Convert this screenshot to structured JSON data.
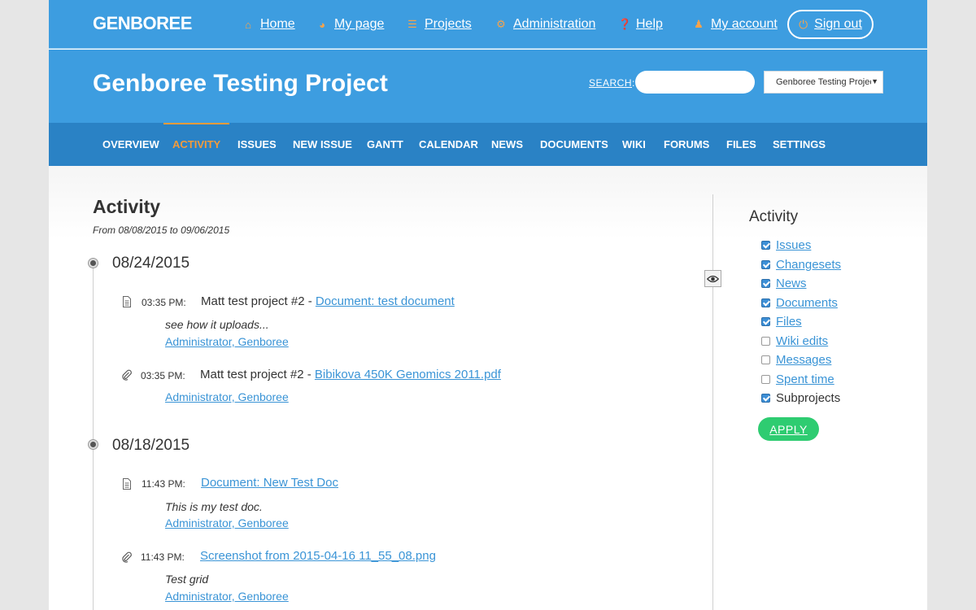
{
  "brand": "GENBOREE",
  "topnav": {
    "home": "Home",
    "my_page": "My page",
    "projects": "Projects",
    "administration": "Administration",
    "help": "Help",
    "my_account": "My account",
    "sign_out": "Sign out"
  },
  "header": {
    "project_title": "Genboree Testing Project",
    "search_label": "SEARCH",
    "search_value": "",
    "project_select": "Genboree Testing Project"
  },
  "tabs": [
    {
      "label": "OVERVIEW"
    },
    {
      "label": "ACTIVITY",
      "selected": true
    },
    {
      "label": "ISSUES"
    },
    {
      "label": "NEW ISSUE"
    },
    {
      "label": "GANTT"
    },
    {
      "label": "CALENDAR"
    },
    {
      "label": "NEWS"
    },
    {
      "label": "DOCUMENTS"
    },
    {
      "label": "WIKI"
    },
    {
      "label": "FORUMS"
    },
    {
      "label": "FILES"
    },
    {
      "label": "SETTINGS"
    }
  ],
  "activity": {
    "title": "Activity",
    "range": "From 08/08/2015 to 09/06/2015",
    "days": [
      {
        "date": "08/24/2015",
        "entries": [
          {
            "icon": "document-icon",
            "time": "03:35 PM:",
            "prefix": "Matt test project #2 - ",
            "link": "Document: test document",
            "description": "see how it uploads...",
            "author": "Administrator, Genboree"
          },
          {
            "icon": "attachment-icon",
            "time": "03:35 PM:",
            "prefix": "Matt test project #2 - ",
            "link": "Bibikova 450K Genomics 2011.pdf",
            "description": "",
            "author": "Administrator, Genboree"
          }
        ]
      },
      {
        "date": "08/18/2015",
        "entries": [
          {
            "icon": "document-icon",
            "time": "11:43 PM:",
            "prefix": "",
            "link": "Document: New Test Doc",
            "description": "This is my test doc.",
            "author": "Administrator, Genboree"
          },
          {
            "icon": "attachment-icon",
            "time": "11:43 PM:",
            "prefix": "",
            "link": "Screenshot from 2015-04-16 11_55_08.png",
            "description": "Test grid",
            "author": "Administrator, Genboree"
          }
        ]
      }
    ]
  },
  "sidebar": {
    "title": "Activity",
    "filters": [
      {
        "label": "Issues",
        "checked": true,
        "link": true
      },
      {
        "label": "Changesets",
        "checked": true,
        "link": true
      },
      {
        "label": "News",
        "checked": true,
        "link": true
      },
      {
        "label": "Documents",
        "checked": true,
        "link": true
      },
      {
        "label": "Files",
        "checked": true,
        "link": true
      },
      {
        "label": "Wiki edits",
        "checked": false,
        "link": true
      },
      {
        "label": "Messages",
        "checked": false,
        "link": true
      },
      {
        "label": "Spent time",
        "checked": false,
        "link": true
      },
      {
        "label": "Subprojects",
        "checked": true,
        "link": false
      }
    ],
    "apply_label": "APPLY"
  },
  "colors": {
    "header_blue": "#3d9de0",
    "tabs_blue": "#2a82c5",
    "accent_orange": "#f39b3b",
    "link_blue": "#3a94d6",
    "apply_green": "#2ecc71"
  }
}
